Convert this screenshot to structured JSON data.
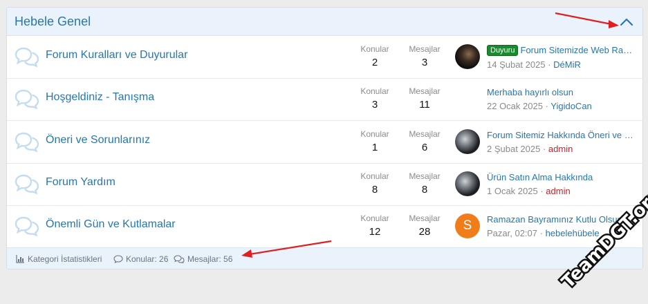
{
  "block": {
    "title": "Hebele Genel",
    "collapse_icon": "chevron-up-icon"
  },
  "forums": [
    {
      "name": "Forum Kuralları ve Duyurular",
      "konular_label": "Konular",
      "konular": "2",
      "mesajlar_label": "Mesajlar",
      "mesajlar": "3",
      "avatar": "dark1",
      "prefix": "Duyuru",
      "latest_title": "Forum Sitemizde Web Rad...",
      "latest_date": "14 Şubat 2025",
      "latest_user": "DéMiR",
      "user_color": "#2577b1"
    },
    {
      "name": "Hoşgeldiniz - Tanışma",
      "konular_label": "Konular",
      "konular": "3",
      "mesajlar_label": "Mesajlar",
      "mesajlar": "11",
      "avatar": "none",
      "prefix": "",
      "latest_title": "Merhaba hayırlı olsun",
      "latest_date": "22 Ocak 2025",
      "latest_user": "YigidoCan",
      "user_color": "#2577b1"
    },
    {
      "name": "Öneri ve Sorunlarınız",
      "konular_label": "Konular",
      "konular": "1",
      "mesajlar_label": "Mesajlar",
      "mesajlar": "6",
      "avatar": "dark2",
      "prefix": "",
      "latest_title": "Forum Sitemiz Hakkında Öneri ve S...",
      "latest_date": "2 Şubat 2025",
      "latest_user": "admin",
      "user_color": "#c0252a"
    },
    {
      "name": "Forum Yardım",
      "konular_label": "Konular",
      "konular": "8",
      "mesajlar_label": "Mesajlar",
      "mesajlar": "8",
      "avatar": "dark2",
      "prefix": "",
      "latest_title": "Ürün Satın Alma Hakkında",
      "latest_date": "1 Ocak 2025",
      "latest_user": "admin",
      "user_color": "#c0252a"
    },
    {
      "name": "Önemli Gün ve Kutlamalar",
      "konular_label": "Konular",
      "konular": "12",
      "mesajlar_label": "Mesajlar",
      "mesajlar": "28",
      "avatar": "letter",
      "avatar_letter": "S",
      "prefix": "",
      "latest_title": "Ramazan Bayramınız Kutlu Olsun",
      "latest_date": "Pazar, 02:07",
      "latest_user": "hebelehübele",
      "user_color": "#2577b1"
    }
  ],
  "footer": {
    "stats_label": "Kategori İstatistikleri",
    "konular_text": "Konular: 26",
    "mesajlar_text": "Mesajlar: 56"
  },
  "watermark": "TeamDGT.org",
  "colors": {
    "link": "#2577b1",
    "header_bg": "#eaf3fb",
    "admin": "#c0252a",
    "prefix_green": "#1b8a2e",
    "annotation_arrow": "#e02020"
  }
}
